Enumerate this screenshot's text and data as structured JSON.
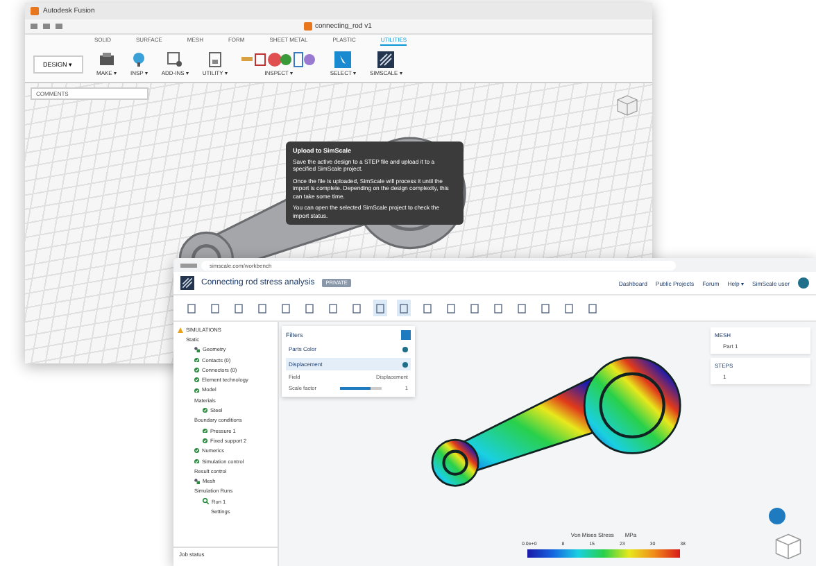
{
  "back_window": {
    "title": "Autodesk Fusion",
    "file_tab": "connecting_rod v1",
    "ribbon_tabs": [
      {
        "label": "SOLID",
        "selected": false
      },
      {
        "label": "SURFACE",
        "selected": false
      },
      {
        "label": "MESH",
        "selected": false
      },
      {
        "label": "FORM",
        "selected": false
      },
      {
        "label": "SHEET METAL",
        "selected": false
      },
      {
        "label": "PLASTIC",
        "selected": false
      },
      {
        "label": "UTILITIES",
        "selected": true
      }
    ],
    "workspace": "DESIGN ▾",
    "tool_groups": [
      {
        "label": "MAKE ▾",
        "kind": "make"
      },
      {
        "label": "INSP ▾",
        "kind": "inspect"
      },
      {
        "label": "ADD-INS ▾",
        "kind": "addins"
      },
      {
        "label": "UTILITY ▾",
        "kind": "utility"
      },
      {
        "label": "INSPECT ▾",
        "kind": "multi"
      },
      {
        "label": "SELECT ▾",
        "kind": "select"
      },
      {
        "label": "SIMSCALE ▾",
        "kind": "simscale"
      }
    ],
    "browser_panel": "COMMENTS",
    "tooltip": {
      "title": "Upload to SimScale",
      "paragraphs": [
        "Save the active design to a STEP file and upload it to a specified SimScale project.",
        "Once the file is uploaded, SimScale will process it until the import is complete. Depending on the design complexity, this can take some time.",
        "You can open the selected SimScale project to check the import status."
      ]
    }
  },
  "front_window": {
    "address": "simscale.com/workbench",
    "title": "Connecting rod stress analysis",
    "badge": "PRIVATE",
    "nav": [
      "Dashboard",
      "Public Projects",
      "Forum",
      "Help ▾",
      "SimScale user"
    ],
    "toolbar": [
      {
        "selected": false
      },
      {
        "selected": false
      },
      {
        "selected": false
      },
      {
        "selected": false
      },
      {
        "selected": false
      },
      {
        "selected": false
      },
      {
        "selected": false
      },
      {
        "selected": false
      },
      {
        "selected": true
      },
      {
        "selected": true
      },
      {
        "selected": false
      },
      {
        "selected": false
      },
      {
        "selected": false
      },
      {
        "selected": false
      },
      {
        "selected": false
      },
      {
        "selected": false
      },
      {
        "selected": false
      },
      {
        "selected": false
      }
    ],
    "tree": [
      {
        "label": "SIMULATIONS",
        "kind": "section",
        "children": [
          {
            "label": "Static",
            "children": [
              {
                "label": "Geometry",
                "kind": "geometry"
              },
              {
                "label": "Contacts (0)",
                "kind": "done"
              },
              {
                "label": "Connectors (0)",
                "kind": "done"
              },
              {
                "label": "Element technology",
                "kind": "done"
              },
              {
                "label": "Model",
                "kind": "done"
              },
              {
                "label": "Materials",
                "children": [
                  {
                    "label": "Steel",
                    "kind": "done"
                  }
                ]
              },
              {
                "label": "Boundary conditions",
                "children": [
                  {
                    "label": "Pressure 1",
                    "kind": "done"
                  },
                  {
                    "label": "Fixed support 2",
                    "kind": "done"
                  }
                ]
              },
              {
                "label": "Numerics",
                "kind": "done"
              },
              {
                "label": "Simulation control",
                "kind": "done"
              },
              {
                "label": "Result control"
              },
              {
                "label": "Mesh",
                "kind": "geometry"
              },
              {
                "label": "Simulation Runs",
                "children": [
                  {
                    "label": "Run 1",
                    "kind": "run",
                    "children": [
                      {
                        "label": "Settings"
                      }
                    ]
                  }
                ]
              }
            ]
          }
        ]
      }
    ],
    "job_status": "Job status",
    "filters": {
      "title": "Filters",
      "layers": [
        {
          "label": "Parts Color",
          "selected": false
        },
        {
          "label": "Displacement",
          "selected": true
        }
      ],
      "field_label": "Field",
      "field_value": "Displacement",
      "scale_label": "Scale factor",
      "scale_value": "1",
      "level": 0.75
    },
    "side_panels": [
      {
        "title": "MESH",
        "item": "Part 1"
      },
      {
        "title": "STEPS",
        "item": "1"
      }
    ],
    "legend": {
      "title": "Von Mises Stress",
      "unit": "MPa",
      "ticks": [
        "0.0e+0",
        "8",
        "15",
        "23",
        "30",
        "38"
      ]
    }
  }
}
